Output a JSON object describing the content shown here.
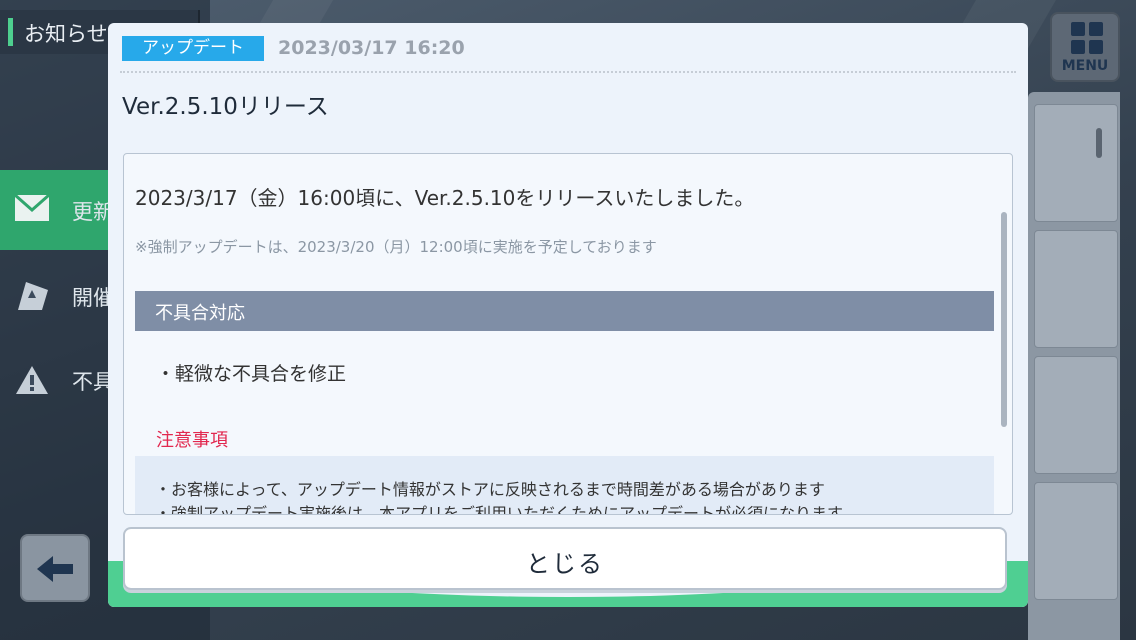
{
  "background": {
    "notice_tab_label": "お知らせ",
    "sidebar": {
      "items": [
        {
          "icon": "envelope-icon",
          "label": "更新"
        },
        {
          "icon": "flag-icon",
          "label": "開催"
        },
        {
          "icon": "warning-icon",
          "label": "不具"
        }
      ]
    },
    "menu_label": "MENU"
  },
  "dialog": {
    "tag": "アップデート",
    "date": "2023/03/17 16:20",
    "title": "Ver.2.5.10リリース",
    "content": {
      "main_text": "2023/3/17（金）16:00頃に、Ver.2.5.10をリリースいたしました。",
      "note": "※強制アップデートは、2023/3/20（月）12:00頃に実施を予定しております",
      "section_heading": "不具合対応",
      "bullet": "・軽微な不具合を修正",
      "warning_heading": "注意事項",
      "warning_lines": [
        "・お客様によって、アップデート情報がストアに反映されるまで時間差がある場合があります",
        "・強制アップデート実施後は、本アプリをご利用いただくためにアップデートが必須になります"
      ]
    },
    "close_label": "とじる"
  },
  "colors": {
    "accent_green": "#4fcf92",
    "tag_blue": "#27a9ea",
    "warning_red": "#e2284f",
    "heading_gray": "#7f8ea6"
  }
}
